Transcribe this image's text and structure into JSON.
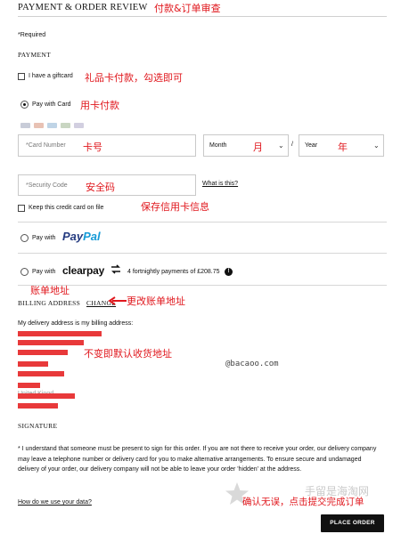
{
  "header": {
    "title": "PAYMENT & ORDER REVIEW",
    "annotation": "付款&订单审查"
  },
  "form": {
    "required_note": "*Required"
  },
  "payment": {
    "heading": "PAYMENT",
    "gift_card": {
      "label": "I have a giftcard",
      "annotation": "礼品卡付款，勾选即可"
    },
    "pay_with_card": {
      "label": "Pay with Card",
      "annotation": "用卡付款"
    },
    "card_logos": [
      {
        "name": "visa-logo",
        "color": "#c8ccd8"
      },
      {
        "name": "mastercard-logo",
        "color": "#e8c2b4"
      },
      {
        "name": "amex-logo",
        "color": "#bfd4e6"
      },
      {
        "name": "maestro-logo",
        "color": "#c9d6c2"
      },
      {
        "name": "jcb-logo",
        "color": "#d2cfe0"
      }
    ],
    "card_number": {
      "placeholder": "*Card Number",
      "annotation": "卡号"
    },
    "month": {
      "label": "Month",
      "annotation": "月"
    },
    "year": {
      "label": "Year",
      "annotation": "年"
    },
    "date_separator": "/",
    "security_code": {
      "placeholder": "*Security Code",
      "annotation": "安全码",
      "help_link": "What is this?"
    },
    "keep_card": {
      "label": "Keep this credit card on file",
      "annotation": "保存信用卡信息"
    },
    "paypal": {
      "prefix": "Pay with",
      "brand_pay": "Pay",
      "brand_pal": "Pal"
    },
    "clearpay": {
      "prefix": "Pay with",
      "brand": "clearpay",
      "arrow_icon": "clearpay-arrows-icon",
      "text": "4 fortnightly payments of £208.75",
      "info_icon": "info-icon"
    }
  },
  "billing": {
    "annotation_top": "账单地址",
    "heading": "BILLING ADDRESS",
    "change_link": "CHANGE",
    "change_annotation": "更改账单地址",
    "delivery_note": "My delivery address is my billing address:",
    "redacted_annotation": "不变即默认收货地址",
    "watermark": "@bacaoo.com",
    "partial_visible": "United Kingd"
  },
  "signature": {
    "heading": "SIGNATURE",
    "text": "* I understand that someone must be present to sign for this order. If you are not there to receive your order, our delivery company may leave a telephone number or delivery card for you to make alternative arrangements. To ensure secure and undamaged delivery of your order, our delivery company will not be able to leave your order 'hidden' at the address."
  },
  "footer": {
    "data_link": "How do we use your data?",
    "confirm_annotation": "确认无误，点击提交完成订单",
    "watermark": "手留是海淘网",
    "place_order": "PLACE ORDER"
  },
  "colors": {
    "annotation_red": "#e0171d",
    "paypal_dark": "#253b80",
    "paypal_light": "#179bd7",
    "redaction": "#e8393a",
    "button": "#111111"
  }
}
